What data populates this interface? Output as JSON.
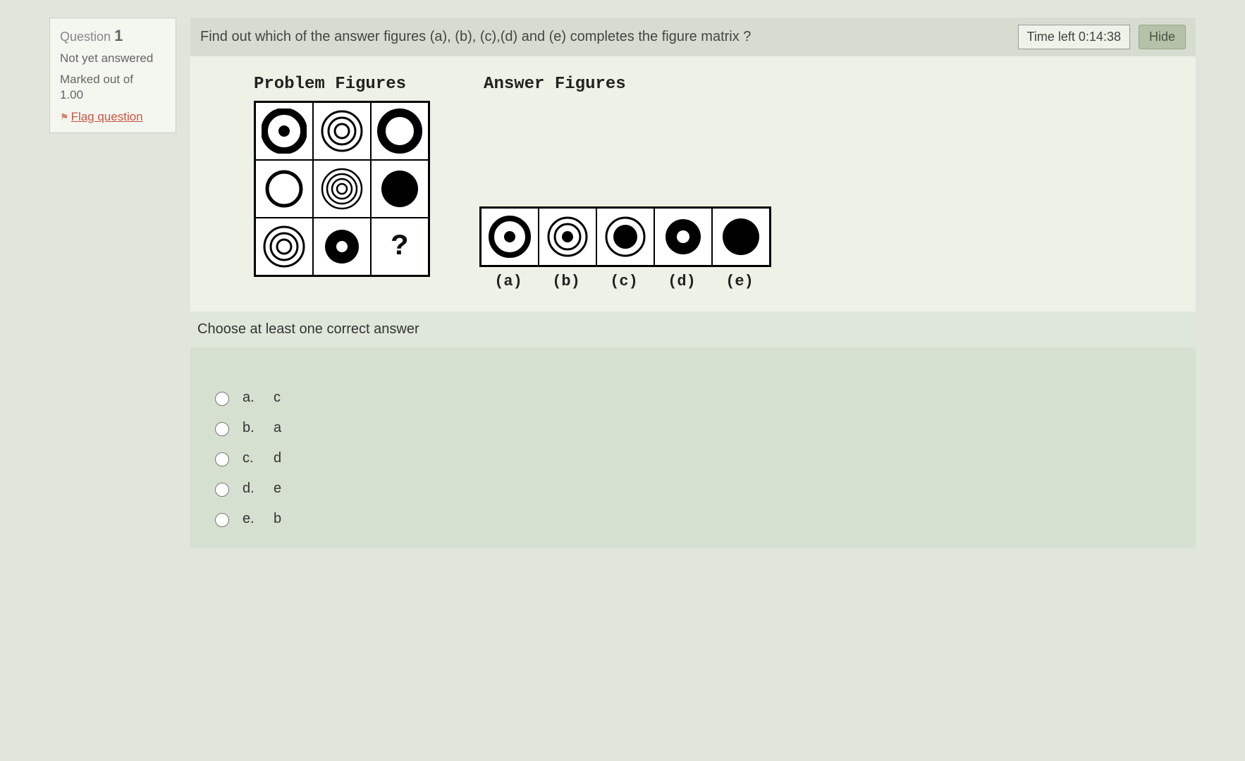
{
  "info": {
    "question_label": "Question",
    "question_number": "1",
    "status": "Not yet answered",
    "marks_label": "Marked out of",
    "marks_value": "1.00",
    "flag_label": "Flag question"
  },
  "topbar": {
    "question_text": "Find out which of the answer figures (a), (b), (c),(d) and (e) completes the figure matrix ?",
    "timer_text": "Time left 0:14:38",
    "hide_label": "Hide"
  },
  "figures": {
    "problem_header": "Problem Figures",
    "answer_header": "Answer Figures",
    "qmark": "?",
    "answer_labels": [
      "(a)",
      "(b)",
      "(c)",
      "(d)",
      "(e)"
    ]
  },
  "instruction": "Choose at least one correct answer",
  "options": [
    {
      "letter": "a.",
      "value": "c"
    },
    {
      "letter": "b.",
      "value": "a"
    },
    {
      "letter": "c.",
      "value": "d"
    },
    {
      "letter": "d.",
      "value": "e"
    },
    {
      "letter": "e.",
      "value": "b"
    }
  ]
}
